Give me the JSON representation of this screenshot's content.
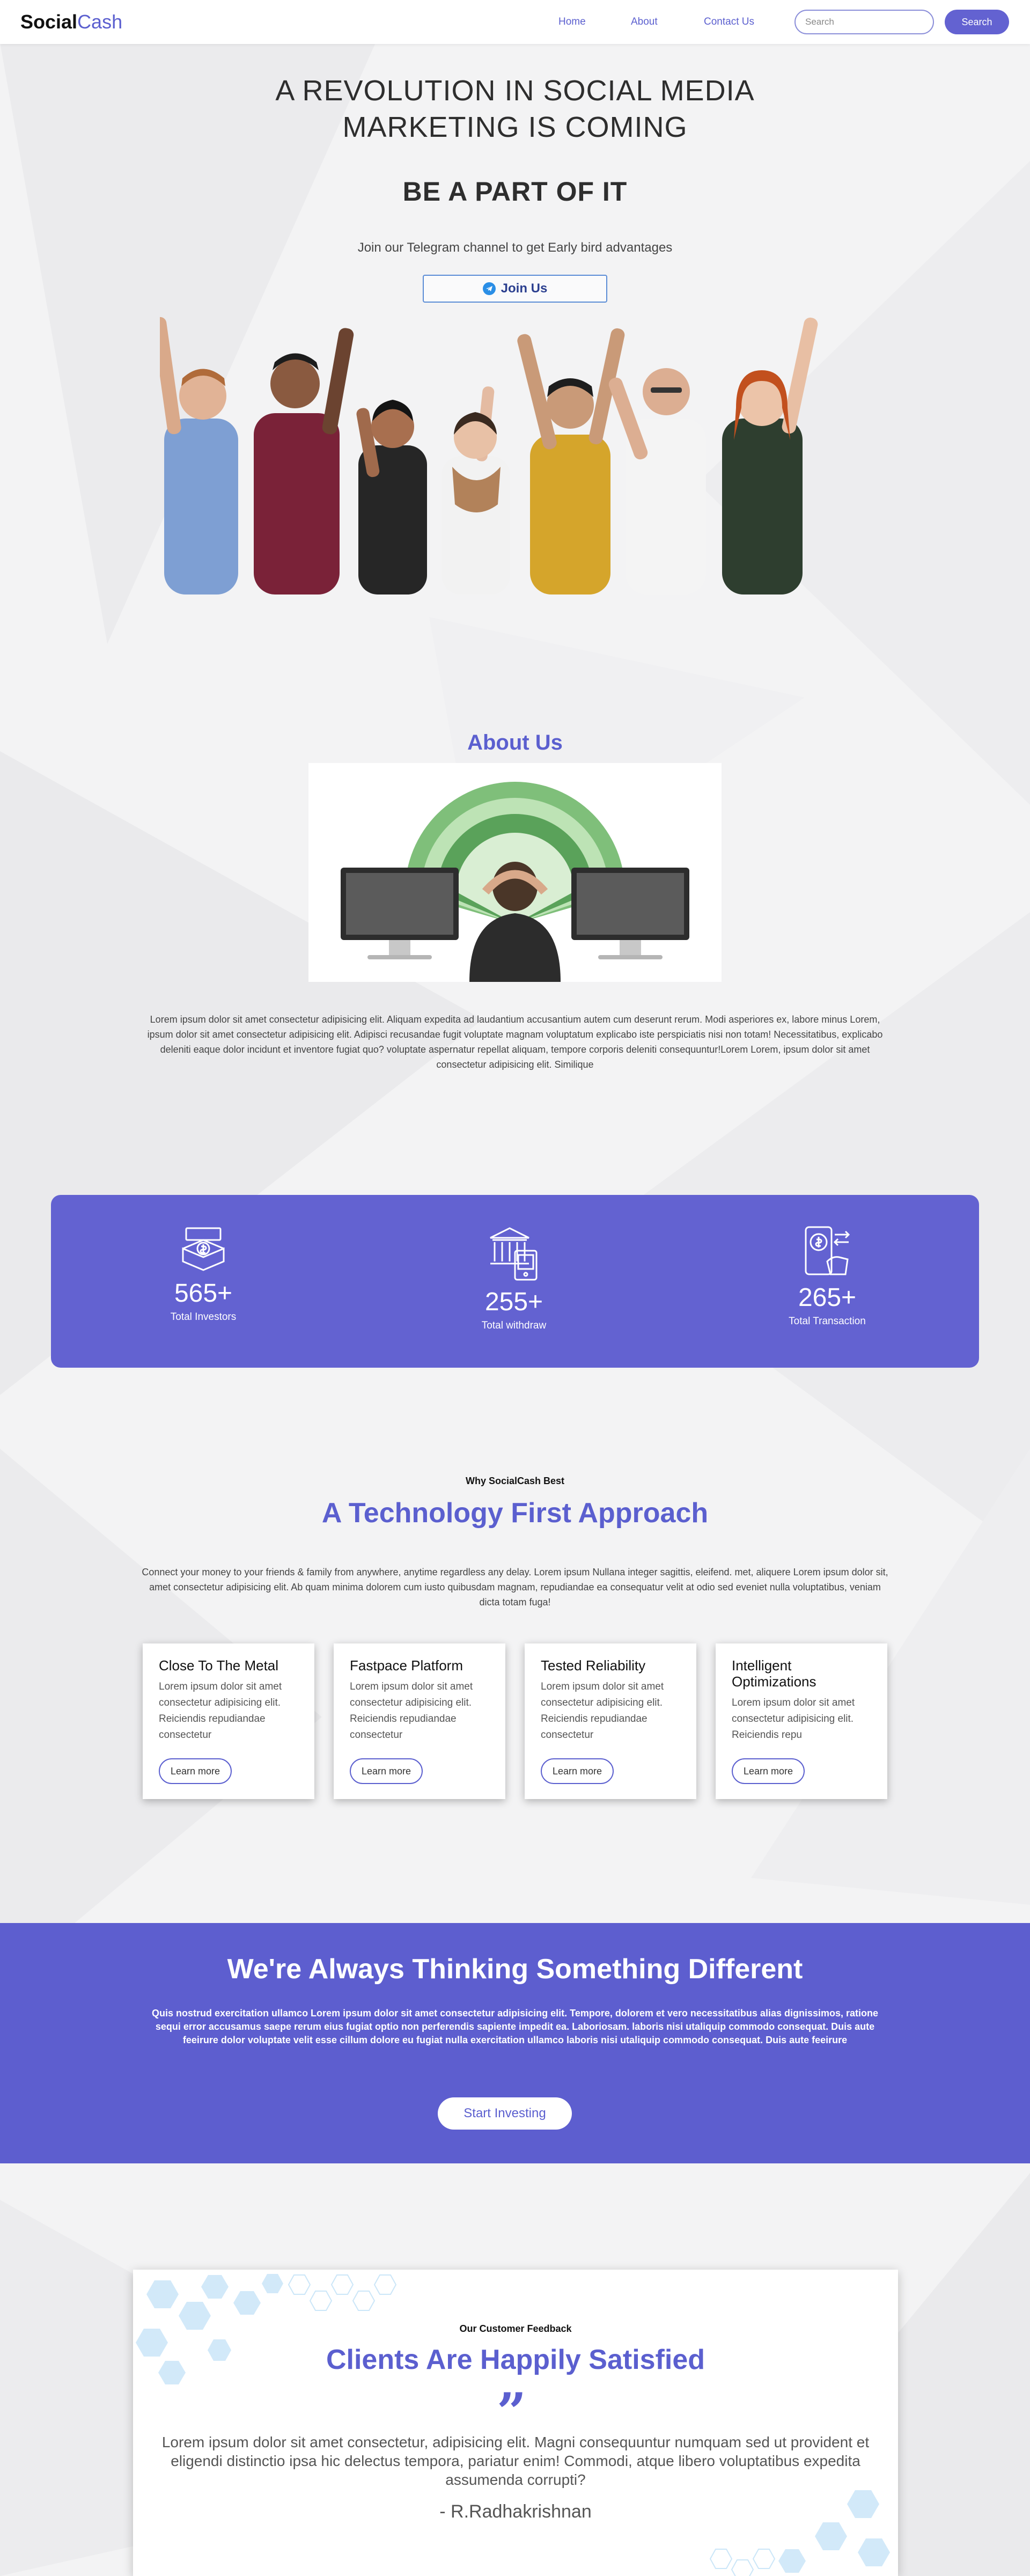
{
  "navbar": {
    "brand_part1": "Social",
    "brand_part2": "Cash",
    "links": [
      {
        "label": "Home"
      },
      {
        "label": "About"
      },
      {
        "label": "Contact Us"
      }
    ],
    "search_placeholder": "Search",
    "search_button": "Search"
  },
  "hero": {
    "title": "A REVOLUTION IN SOCIAL MEDIA MARKETING IS COMING",
    "subtitle": "BE A PART OF IT",
    "text": "Join our Telegram channel to get Early bird advantages",
    "join_button": "Join Us"
  },
  "about": {
    "title": "About Us",
    "text": "Lorem ipsum dolor sit amet consectetur adipisicing elit. Aliquam expedita ad laudantium accusantium autem cum deserunt rerum. Modi asperiores ex, labore minus Lorem, ipsum dolor sit amet consectetur adipisicing elit. Adipisci recusandae fugit voluptate magnam voluptatum explicabo iste perspiciatis nisi non totam! Necessitatibus, explicabo deleniti eaque dolor incidunt et inventore fugiat quo? voluptate aspernatur repellat aliquam, tempore corporis deleniti consequuntur!Lorem Lorem, ipsum dolor sit amet consectetur adipisicing elit. Similique"
  },
  "stats": [
    {
      "value": "565+",
      "label": "Total Investors",
      "icon": "investment-box-icon"
    },
    {
      "value": "255+",
      "label": "Total withdraw",
      "icon": "bank-withdraw-icon"
    },
    {
      "value": "265+",
      "label": "Total Transaction",
      "icon": "mobile-transfer-icon"
    }
  ],
  "why": {
    "small_title": "Why SocialCash Best",
    "title": "A Technology First Approach",
    "text": "Connect your money to your friends & family from anywhere, anytime regardless any delay. Lorem ipsum Nullana integer sagittis, eleifend. met, aliquere Lorem ipsum dolor sit, amet consectetur adipisicing elit. Ab quam minima dolorem cum iusto quibusdam magnam, repudiandae ea consequatur velit at odio sed eveniet nulla voluptatibus, veniam dicta totam fuga!",
    "cards": [
      {
        "title": "Close To The Metal",
        "text": "Lorem ipsum dolor sit amet consectetur adipisicing elit. Reiciendis repudiandae consectetur",
        "button": "Learn more"
      },
      {
        "title": "Fastpace Platform",
        "text": "Lorem ipsum dolor sit amet consectetur adipisicing elit. Reiciendis repudiandae consectetur",
        "button": "Learn more"
      },
      {
        "title": "Tested Reliability",
        "text": "Lorem ipsum dolor sit amet consectetur adipisicing elit. Reiciendis repudiandae consectetur",
        "button": "Learn more"
      },
      {
        "title": "Intelligent Optimizations",
        "text": "Lorem ipsum dolor sit amet consectetur adipisicing elit. Reiciendis repu",
        "button": "Learn more"
      }
    ]
  },
  "band": {
    "title": "We're Always Thinking Something Different",
    "text": "Quis nostrud exercitation ullamco Lorem ipsum dolor sit amet consectetur adipisicing elit. Tempore, dolorem et vero necessitatibus alias dignissimos, ratione sequi error accusamus saepe rerum eius fugiat optio non perferendis sapiente impedit ea. Laboriosam. laboris nisi utaliquip commodo consequat. Duis aute feeirure dolor voluptate velit esse cillum dolore eu fugiat nulla exercitation ullamco laboris nisi utaliquip commodo consequat. Duis aute feeirure",
    "button": "Start Investing"
  },
  "feedback": {
    "small_title": "Our Customer Feedback",
    "title": "Clients Are Happily Satisfied",
    "quote_mark": "”",
    "text": "Lorem ipsum dolor sit amet consectetur, adipisicing elit. Magni consequuntur numquam sed ut provident et eligendi distinctio ipsa hic delectus tempora, pariatur enim! Commodi, atque libero voluptatibus expedita assumenda corrupti?",
    "author": "- R.Radhakrishnan"
  },
  "colors": {
    "accent": "#6362d1",
    "band": "#5d5ecf",
    "text": "#333333"
  }
}
